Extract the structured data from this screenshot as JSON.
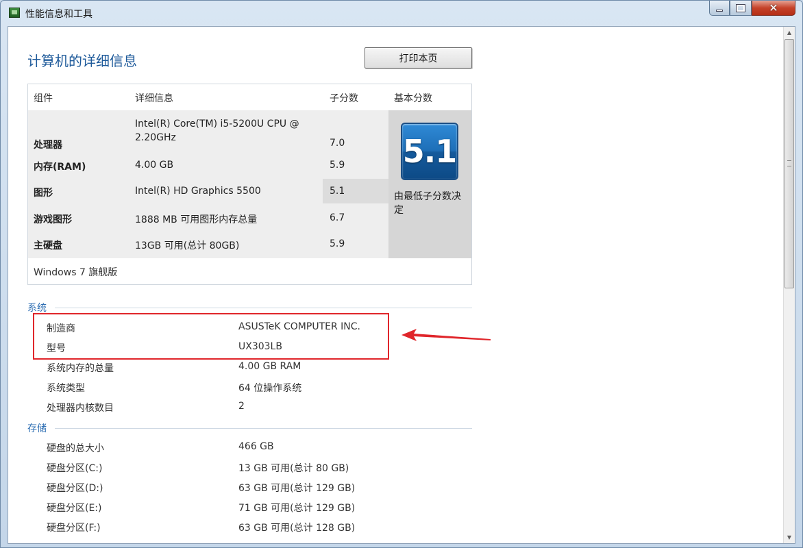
{
  "window": {
    "title": "性能信息和工具",
    "buttons": {
      "minimize": "—",
      "maximize": "□",
      "close": "✕"
    }
  },
  "page": {
    "title": "计算机的详细信息",
    "print_button": "打印本页"
  },
  "score_table": {
    "headers": {
      "component": "组件",
      "detail": "详细信息",
      "subscore": "子分数",
      "basescore": "基本分数"
    },
    "rows": [
      {
        "component": "处理器",
        "detail": "Intel(R) Core(TM) i5-5200U CPU @ 2.20GHz",
        "subscore": "7.0"
      },
      {
        "component": "内存(RAM)",
        "detail": "4.00 GB",
        "subscore": "5.9"
      },
      {
        "component": "图形",
        "detail": "Intel(R) HD Graphics 5500",
        "subscore": "5.1"
      },
      {
        "component": "游戏图形",
        "detail": "1888 MB 可用图形内存总量",
        "subscore": "6.7"
      },
      {
        "component": "主硬盘",
        "detail": "13GB 可用(总计 80GB)",
        "subscore": "5.9"
      }
    ],
    "base_score": "5.1",
    "base_caption": "由最低子分数决定",
    "os_edition": "Windows 7 旗舰版"
  },
  "system": {
    "section_label": "系统",
    "rows": [
      {
        "key": "制造商",
        "value": "ASUSTeK COMPUTER INC."
      },
      {
        "key": "型号",
        "value": "UX303LB"
      },
      {
        "key": "系统内存的总量",
        "value": "4.00 GB RAM"
      },
      {
        "key": "系统类型",
        "value": "64 位操作系统"
      },
      {
        "key": "处理器内核数目",
        "value": "2"
      }
    ]
  },
  "storage": {
    "section_label": "存储",
    "rows": [
      {
        "key": "硬盘的总大小",
        "value": "466 GB"
      },
      {
        "key": "硬盘分区(C:)",
        "value": "13 GB 可用(总计 80 GB)"
      },
      {
        "key": "硬盘分区(D:)",
        "value": "63 GB 可用(总计 129 GB)"
      },
      {
        "key": "硬盘分区(E:)",
        "value": "71 GB 可用(总计 129 GB)"
      },
      {
        "key": "硬盘分区(F:)",
        "value": "63 GB 可用(总计 128 GB)"
      }
    ]
  },
  "colors": {
    "accent_blue": "#1e5a9a",
    "annotation_red": "#e0262b"
  }
}
